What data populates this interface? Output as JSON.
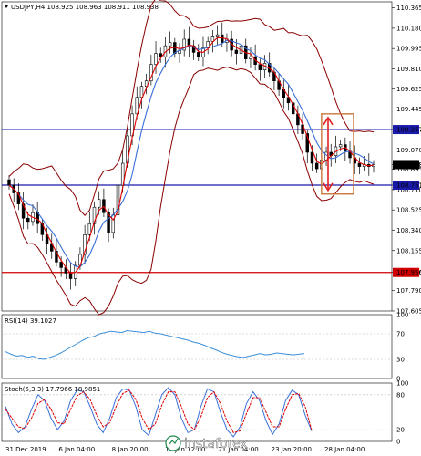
{
  "chart_data": [
    {
      "type": "candlestick",
      "symbol_label": "USDJPY,H4",
      "ohlc_label": "108.925 108.963 108.911 108.938",
      "y_ticks": [
        "110.365",
        "110.180",
        "109.995",
        "109.810",
        "109.625",
        "109.445",
        "109.257",
        "109.070",
        "108.938",
        "108.895",
        "108.751",
        "108.710",
        "108.525",
        "108.340",
        "108.155",
        "107.956",
        "107.790",
        "107.605"
      ],
      "ylim": [
        107.605,
        110.42
      ],
      "x_ticks": [
        "31 Dec 2019",
        "6 Jan 04:00",
        "8 Jan 20:00",
        "13 Jan 12:00",
        "21 Jan 04:00",
        "23 Jan 20:00",
        "28 Jan 04:00"
      ],
      "levels": [
        {
          "value": 109.257,
          "label": "109.257",
          "color": "#1a1aa8"
        },
        {
          "value": 108.751,
          "label": "108.751",
          "color": "#1a1aa8"
        },
        {
          "value": 107.956,
          "label": "107.956",
          "color": "#d00000"
        }
      ],
      "current_price": {
        "value": 108.938,
        "label": "108.938"
      },
      "series": [
        {
          "name": "close",
          "values": [
            108.75,
            108.68,
            108.58,
            108.45,
            108.42,
            108.5,
            108.4,
            108.3,
            108.22,
            108.15,
            108.05,
            108.0,
            107.95,
            107.9,
            108.02,
            108.12,
            108.3,
            108.4,
            108.55,
            108.62,
            108.5,
            108.32,
            108.48,
            108.75,
            108.95,
            109.2,
            109.4,
            109.55,
            109.65,
            109.7,
            109.85,
            109.95,
            109.92,
            110.02,
            110.05,
            109.95,
            109.98,
            110.08,
            110.02,
            109.96,
            109.92,
            110.0,
            110.06,
            110.1,
            110.12,
            110.05,
            110.08,
            109.98,
            109.95,
            110.02,
            109.9,
            109.92,
            109.85,
            109.8,
            109.86,
            109.78,
            109.7,
            109.62,
            109.55,
            109.5,
            109.4,
            109.3,
            109.22,
            109.05,
            108.95,
            108.9,
            108.98,
            109.05,
            109.02,
            109.1,
            109.12,
            109.06,
            109.0,
            108.95,
            108.92,
            108.94,
            108.92,
            108.938
          ]
        }
      ]
    },
    {
      "type": "line",
      "label": "RSI(14) 39.1027",
      "ylim": [
        0,
        100
      ],
      "y_ticks": [
        "100",
        "70",
        "30",
        "0"
      ],
      "series": [
        {
          "name": "RSI(14)",
          "values": [
            42,
            38,
            35,
            36,
            33,
            35,
            31,
            30,
            33,
            36,
            40,
            45,
            50,
            55,
            60,
            64,
            66,
            70,
            72,
            74,
            73,
            72,
            75,
            74,
            73,
            72,
            74,
            71,
            70,
            68,
            66,
            64,
            62,
            60,
            57,
            55,
            52,
            48,
            45,
            41,
            38,
            36,
            34,
            33,
            35,
            37,
            39,
            37,
            38,
            40,
            39,
            38,
            37,
            38,
            39.1027
          ]
        }
      ]
    },
    {
      "type": "line",
      "label": "Stoch(5,3,3) 17.7966 18.9851",
      "ylim": [
        0,
        100
      ],
      "y_ticks": [
        "100",
        "80",
        "20",
        "0"
      ],
      "series": [
        {
          "name": "%K",
          "values": [
            60,
            30,
            15,
            25,
            55,
            80,
            70,
            40,
            20,
            35,
            70,
            88,
            85,
            60,
            30,
            15,
            40,
            75,
            90,
            88,
            60,
            20,
            10,
            45,
            80,
            92,
            80,
            40,
            15,
            20,
            60,
            90,
            85,
            50,
            20,
            8,
            25,
            65,
            85,
            70,
            35,
            12,
            30,
            70,
            88,
            80,
            45,
            17.7966
          ]
        },
        {
          "name": "%D",
          "values": [
            55,
            40,
            25,
            22,
            40,
            65,
            72,
            55,
            32,
            30,
            55,
            78,
            85,
            72,
            45,
            25,
            32,
            60,
            82,
            88,
            72,
            40,
            20,
            30,
            62,
            85,
            85,
            60,
            30,
            20,
            42,
            75,
            85,
            65,
            35,
            15,
            18,
            48,
            75,
            75,
            50,
            25,
            25,
            55,
            80,
            82,
            60,
            18.9851
          ]
        }
      ]
    }
  ],
  "watermark": "instaforex",
  "colors": {
    "levels_blue": "#1a1aa8",
    "support_red": "#d00000",
    "bands": "#8b0000",
    "ma_fast": "#e00000",
    "ma_slow": "#3a6fd8",
    "rsi": "#3a8fd8",
    "box": "#c8763a",
    "arrow": "#e02020"
  }
}
